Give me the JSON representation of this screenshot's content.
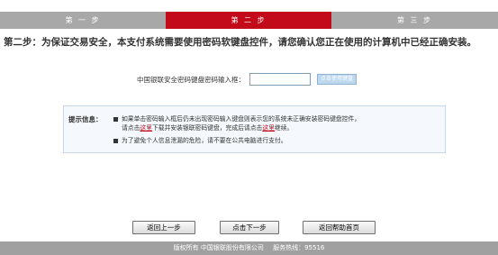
{
  "steps": [
    "第 一 步",
    "第 二 步",
    "第 三 步"
  ],
  "heading": "第二步：为保证交易安全，本支付系统需要使用密码软键盘控件，请您确认您正在使用的计算机中已经正确安装。",
  "password": {
    "label": "中国银联安全密码键盘密码输入框：",
    "value": "",
    "keyboard_button": "点击使用键盘"
  },
  "tips": {
    "label": "提示信息：",
    "line1": "如果单击密码输入框后仍未出现密码输入键盘则表示您的系统未正确安装密码键盘控件，",
    "line2_a": "请点击",
    "line2_link1": "这里",
    "line2_b": "下载并安装银联密码键盘，完成后请点击",
    "line2_link2": "这里",
    "line2_c": "继续。",
    "line3": "为了避免个人信息泄漏的危险，请不要在公共电脑进行支付。"
  },
  "buttons": {
    "prev": "返回上一步",
    "next": "点击下一步",
    "help": "返回帮助首页"
  },
  "footer": {
    "copyright": "版权所有  中国银联股份有限公司",
    "hotline": "服务热线：95516"
  },
  "colors": {
    "active_step": "#c20a1a",
    "inactive_step": "#a8a8a8",
    "footer": "#a0a0a0"
  }
}
